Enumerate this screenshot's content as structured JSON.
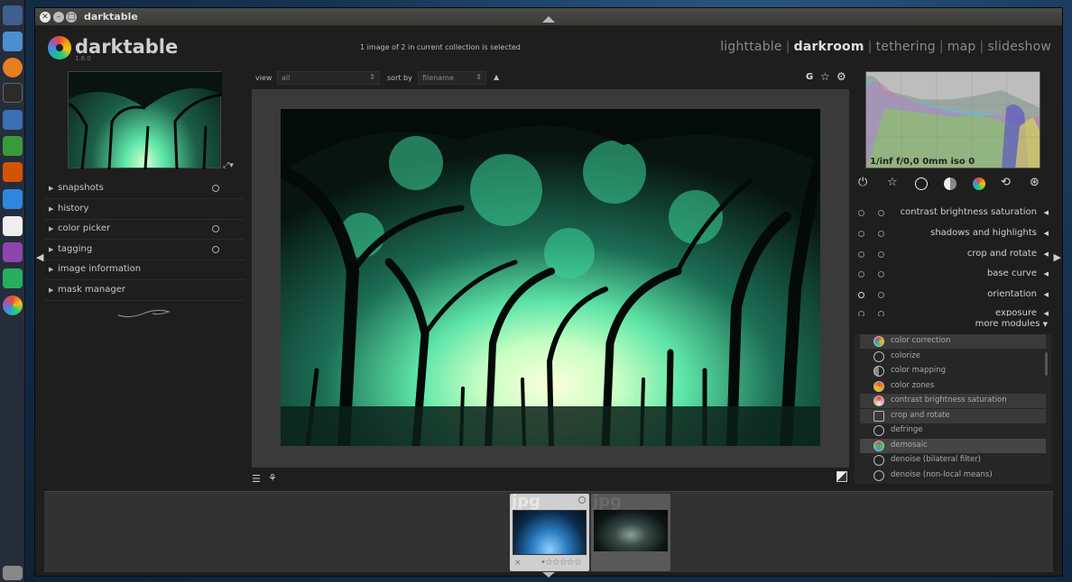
{
  "window": {
    "title": "darktable"
  },
  "app": {
    "name": "darktable",
    "version": "1.6.0"
  },
  "status": "1 image of 2 in current collection is selected",
  "views": {
    "items": [
      "lighttable",
      "darkroom",
      "tethering",
      "map",
      "slideshow"
    ],
    "separator": "|"
  },
  "toolbar": {
    "view_label": "view",
    "view_value": "all",
    "sort_label": "sort by",
    "sort_value": "filename",
    "grouping_label": "G"
  },
  "left_panel": {
    "items": [
      {
        "label": "snapshots"
      },
      {
        "label": "history"
      },
      {
        "label": "color picker"
      },
      {
        "label": "tagging"
      },
      {
        "label": "image information"
      },
      {
        "label": "mask manager"
      }
    ]
  },
  "histogram": {
    "info": "1/inf f/0,0 0mm iso 0"
  },
  "modules": {
    "active": [
      {
        "label": "contrast brightness saturation"
      },
      {
        "label": "shadows and highlights"
      },
      {
        "label": "crop and rotate"
      },
      {
        "label": "base curve"
      },
      {
        "label": "orientation"
      },
      {
        "label": "exposure"
      }
    ],
    "more_label": "more modules",
    "list": [
      {
        "label": "color correction"
      },
      {
        "label": "colorize"
      },
      {
        "label": "color mapping"
      },
      {
        "label": "color zones"
      },
      {
        "label": "contrast brightness saturation"
      },
      {
        "label": "crop and rotate"
      },
      {
        "label": "defringe"
      },
      {
        "label": "demosaic"
      },
      {
        "label": "denoise (bilateral filter)"
      },
      {
        "label": "denoise (non-local means)"
      }
    ]
  },
  "filmstrip": {
    "items": [
      {
        "ext": "jpg",
        "selected": true
      },
      {
        "ext": "jpg",
        "selected": false
      }
    ],
    "reject_label": "×"
  },
  "colors": {
    "accent_green": "#5fe6a8",
    "panel": "#1e1e1e",
    "canvas": "#3a3a3a"
  }
}
